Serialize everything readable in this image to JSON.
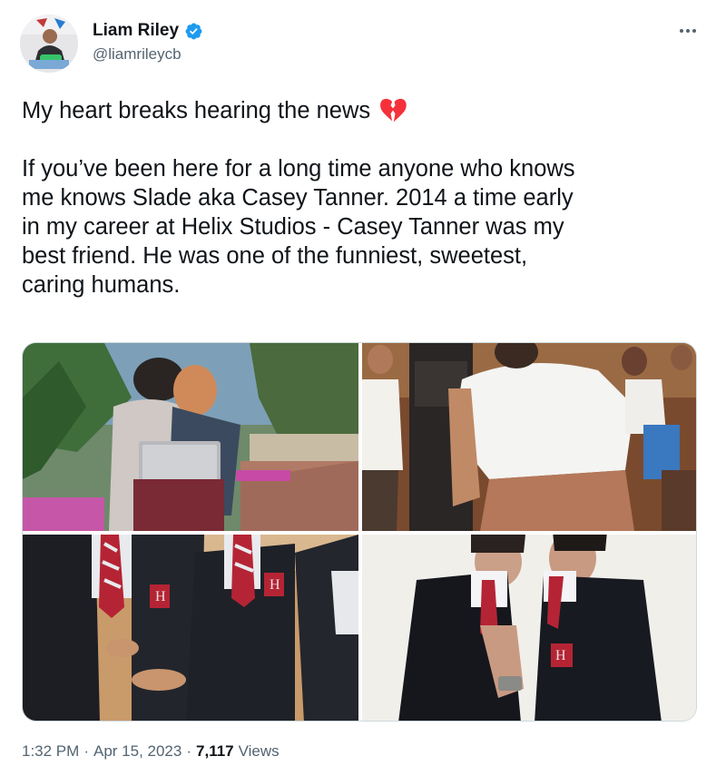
{
  "author": {
    "display_name": "Liam Riley",
    "handle": "@liamrileycb",
    "verified": true,
    "verified_color": "#1d9bf0"
  },
  "tweet": {
    "line1": "My heart breaks hearing the news",
    "line1_emoji": "broken-heart-icon",
    "paragraph_lines": [
      "If you’ve been here for a long time anyone who knows",
      "me knows Slade aka Casey Tanner. 2014 a time early",
      "in my career at Helix Studios - Casey Tanner was my",
      "best friend. He was one of the funniest, sweetest,",
      "caring humans."
    ]
  },
  "media": [
    {
      "name": "photo-hug-laptop"
    },
    {
      "name": "photo-white-tshirt"
    },
    {
      "name": "photo-blazers-group"
    },
    {
      "name": "photo-blazers-kiss"
    }
  ],
  "meta": {
    "time": "1:32 PM",
    "sep1": "·",
    "date": "Apr 15, 2023",
    "sep2": "·",
    "views_count": "7,117",
    "views_label": "Views"
  },
  "colors": {
    "text": "#0f1419",
    "secondary": "#536471",
    "verified": "#1d9bf0",
    "heart": "#f4313a"
  }
}
